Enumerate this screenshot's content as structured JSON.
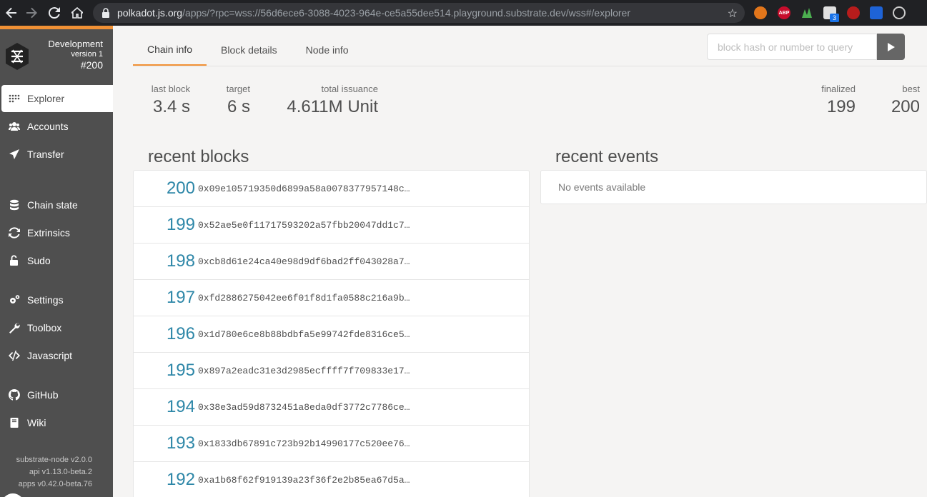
{
  "browser": {
    "url_host": "polkadot.js.org",
    "url_rest": "/apps/?rpc=wss://56d6ece6-3088-4023-964e-ce5a55dee514.playground.substrate.dev/wss#/explorer",
    "extensions": [
      "metamask-icon",
      "adblock-icon",
      "chart-icon",
      "translate-icon",
      "red-ext-icon",
      "blue-ext-icon",
      "circle-ext-icon"
    ],
    "badge_count": "3",
    "adblock_label": "ABP"
  },
  "sidebar": {
    "brand": {
      "name": "Development",
      "version": "version 1",
      "block": "#200"
    },
    "items": [
      {
        "label": "Explorer",
        "icon": "explorer-grid-icon",
        "active": true
      },
      {
        "label": "Accounts",
        "icon": "users-icon"
      },
      {
        "label": "Transfer",
        "icon": "send-icon"
      },
      {
        "label": "Chain state",
        "icon": "database-icon"
      },
      {
        "label": "Extrinsics",
        "icon": "sync-icon"
      },
      {
        "label": "Sudo",
        "icon": "unlock-icon"
      },
      {
        "label": "Settings",
        "icon": "gears-icon"
      },
      {
        "label": "Toolbox",
        "icon": "wrench-icon"
      },
      {
        "label": "Javascript",
        "icon": "code-icon"
      },
      {
        "label": "GitHub",
        "icon": "github-icon"
      },
      {
        "label": "Wiki",
        "icon": "book-icon"
      }
    ],
    "versions": [
      "substrate-node v2.0.0",
      "api v1.13.0-beta.2",
      "apps v0.42.0-beta.76"
    ]
  },
  "tabs": [
    {
      "label": "Chain info",
      "active": true
    },
    {
      "label": "Block details"
    },
    {
      "label": "Node info"
    }
  ],
  "search": {
    "placeholder": "block hash or number to query"
  },
  "stats": {
    "last_block": {
      "label": "last block",
      "value": "3.4 s"
    },
    "target": {
      "label": "target",
      "value": "6 s"
    },
    "total_issuance": {
      "label": "total issuance",
      "value": "4.611M Unit"
    },
    "finalized": {
      "label": "finalized",
      "value": "199"
    },
    "best": {
      "label": "best",
      "value": "200"
    }
  },
  "recent_blocks": {
    "title": "recent blocks",
    "rows": [
      {
        "number": "200",
        "hash": "0x09e105719350d6899a58a0078377957148c…"
      },
      {
        "number": "199",
        "hash": "0x52ae5e0f11717593202a57fbb20047dd1c7…"
      },
      {
        "number": "198",
        "hash": "0xcb8d61e24ca40e98d9df6bad2ff043028a7…"
      },
      {
        "number": "197",
        "hash": "0xfd2886275042ee6f01f8d1fa0588c216a9b…"
      },
      {
        "number": "196",
        "hash": "0x1d780e6ce8b88bdbfa5e99742fde8316ce5…"
      },
      {
        "number": "195",
        "hash": "0x897a2eadc31e3d2985ecffff7f709833e17…"
      },
      {
        "number": "194",
        "hash": "0x38e3ad59d8732451a8eda0df3772c7786ce…"
      },
      {
        "number": "193",
        "hash": "0x1833db67891c723b92b14990177c520ee76…"
      },
      {
        "number": "192",
        "hash": "0xa1b68f62f919139a23f36f2e2b85ea67d5a…"
      }
    ]
  },
  "recent_events": {
    "title": "recent events",
    "empty": "No events available"
  },
  "colors": {
    "accent": "#f19135",
    "sidebar": "#4f4f4f",
    "link": "#2e87a8"
  }
}
